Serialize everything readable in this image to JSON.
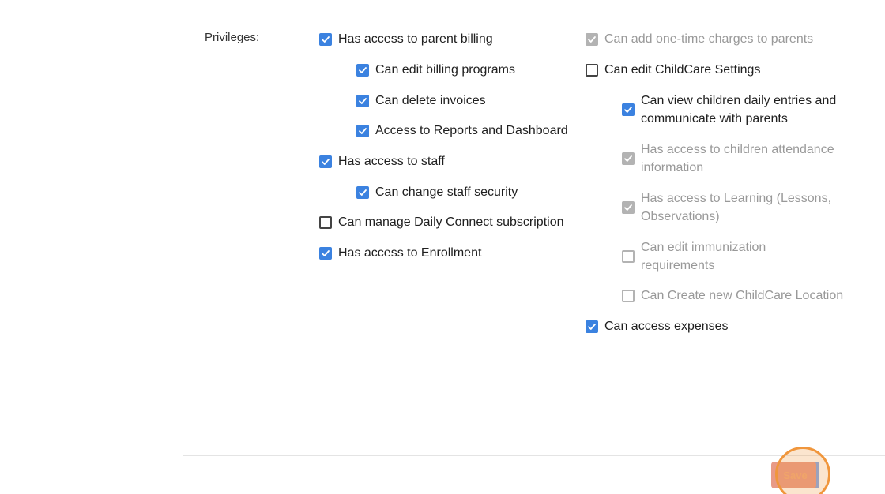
{
  "privileges_label": "Privileges:",
  "left_column": [
    {
      "label": "Has access to parent billing",
      "state": "checked"
    },
    {
      "label": "Can edit billing programs",
      "state": "checked"
    },
    {
      "label": "Can delete invoices",
      "state": "checked"
    },
    {
      "label": "Access to Reports and Dashboard",
      "state": "checked"
    },
    {
      "label": "Has access to staff",
      "state": "checked"
    },
    {
      "label": "Can change staff security",
      "state": "checked"
    },
    {
      "label": "Can manage Daily Connect subscription",
      "state": "unchecked"
    },
    {
      "label": "Has access to Enrollment",
      "state": "checked"
    }
  ],
  "right_column": [
    {
      "lines": [
        "Can add one-time charges to parents"
      ],
      "state": "checked-disabled"
    },
    {
      "lines": [
        "Can edit ChildCare Settings"
      ],
      "state": "unchecked"
    },
    {
      "lines": [
        "Can view children daily entries and",
        "communicate with parents"
      ],
      "state": "checked"
    },
    {
      "lines": [
        "Has access to children attendance",
        "information"
      ],
      "state": "checked-disabled"
    },
    {
      "lines": [
        "Has access to Learning (Lessons,",
        "Observations)"
      ],
      "state": "checked-disabled"
    },
    {
      "lines": [
        "Can edit immunization",
        "requirements"
      ],
      "state": "unchecked-disabled"
    },
    {
      "lines": [
        "Can Create new ChildCare Location"
      ],
      "state": "unchecked-disabled"
    },
    {
      "lines": [
        "Can access expenses"
      ],
      "state": "checked"
    }
  ],
  "save_label": "Save",
  "colors": {
    "checkbox_on": "#3b82e0",
    "checkbox_disabled": "#b3b3b3",
    "save_button": "#e89a86",
    "click_highlight": "#f0963c"
  }
}
